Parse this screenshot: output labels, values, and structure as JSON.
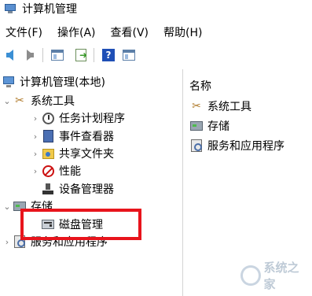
{
  "window": {
    "title": "计算机管理"
  },
  "menu": {
    "items": [
      "文件(F)",
      "操作(A)",
      "查看(V)",
      "帮助(H)"
    ]
  },
  "toolbar": {
    "icons": [
      "back-arrow-icon",
      "forward-arrow-icon",
      "show-hide-tree-icon",
      "export-list-icon",
      "help-icon",
      "properties-icon"
    ]
  },
  "tree": {
    "root": "计算机管理(本地)",
    "system_tools": "系统工具",
    "task_scheduler": "任务计划程序",
    "event_viewer": "事件查看器",
    "shared_folders": "共享文件夹",
    "performance": "性能",
    "device_manager": "设备管理器",
    "storage": "存储",
    "disk_management": "磁盘管理",
    "services_apps": "服务和应用程序"
  },
  "details": {
    "column_name": "名称",
    "items": [
      "系统工具",
      "存储",
      "服务和应用程序"
    ]
  },
  "watermark": {
    "text": "系统之家"
  },
  "colors": {
    "highlight": "#e8141c",
    "accent": "#3b8fd4"
  }
}
